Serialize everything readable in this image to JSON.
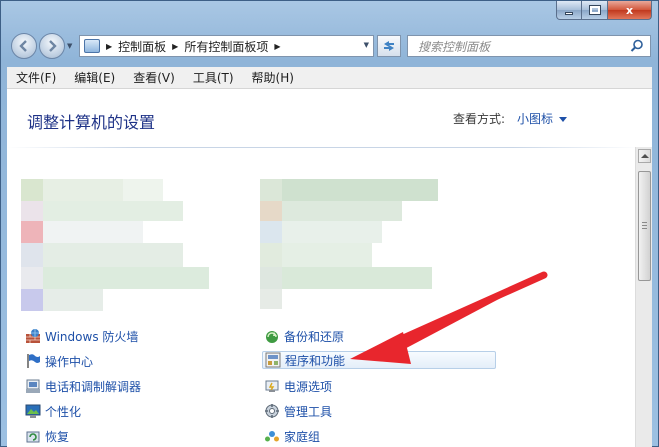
{
  "window": {
    "min_label": "",
    "max_label": "",
    "close_label": "x"
  },
  "address": {
    "crumbs": [
      "控制面板",
      "所有控制面板项"
    ]
  },
  "search": {
    "placeholder": "搜索控制面板"
  },
  "menu": [
    "文件(F)",
    "编辑(E)",
    "查看(V)",
    "工具(T)",
    "帮助(H)"
  ],
  "page": {
    "title": "调整计算机的设置",
    "view_by_label": "查看方式:",
    "view_mode": "小图标"
  },
  "items_left": [
    {
      "label": "Windows 防火墙",
      "icon": "firewall-icon"
    },
    {
      "label": "操作中心",
      "icon": "flag-icon"
    },
    {
      "label": "电话和调制解调器",
      "icon": "phone-modem-icon"
    },
    {
      "label": "个性化",
      "icon": "personalize-icon"
    },
    {
      "label": "恢复",
      "icon": "recovery-icon"
    }
  ],
  "items_right": [
    {
      "label": "备份和还原",
      "icon": "backup-icon"
    },
    {
      "label": "程序和功能",
      "icon": "programs-icon"
    },
    {
      "label": "电源选项",
      "icon": "power-icon"
    },
    {
      "label": "管理工具",
      "icon": "admin-tools-icon"
    },
    {
      "label": "家庭组",
      "icon": "homegroup-icon"
    }
  ],
  "colors": {
    "link": "#1e50a8",
    "title": "#1e3287",
    "arrow": "#e8262d"
  }
}
